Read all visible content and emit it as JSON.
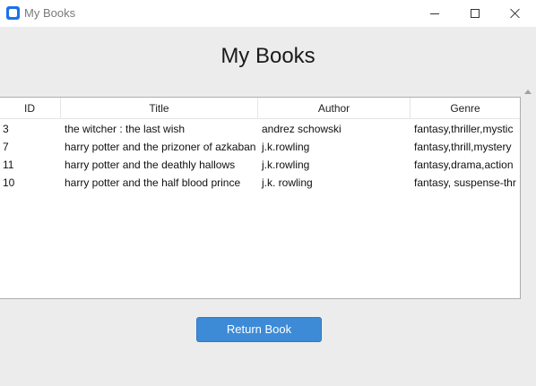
{
  "window": {
    "title": "My Books"
  },
  "page": {
    "heading": "My Books"
  },
  "table": {
    "columns": [
      "ID",
      "Title",
      "Author",
      "Genre"
    ],
    "rows": [
      {
        "id": "3",
        "title": "the witcher : the last wish",
        "author": "andrez schowski",
        "genre": "fantasy,thriller,mystic"
      },
      {
        "id": "7",
        "title": "harry potter and the prizoner of azkaban",
        "author": "j.k.rowling",
        "genre": "fantasy,thrill,mystery"
      },
      {
        "id": "11",
        "title": "harry potter and the deathly hallows",
        "author": "j.k.rowling",
        "genre": "fantasy,drama,action"
      },
      {
        "id": "10",
        "title": "harry potter and the half blood prince",
        "author": "j.k. rowling",
        "genre": "fantasy, suspense-thr"
      }
    ]
  },
  "actions": {
    "return_label": "Return Book"
  },
  "colors": {
    "accent": "#3d8bd6",
    "app_icon": "#1a73e8"
  },
  "icons": {
    "app": "app-logo-icon",
    "minimize": "minimize-icon",
    "maximize": "maximize-icon",
    "close": "close-icon",
    "scroll_up": "scroll-up-arrow-icon"
  }
}
